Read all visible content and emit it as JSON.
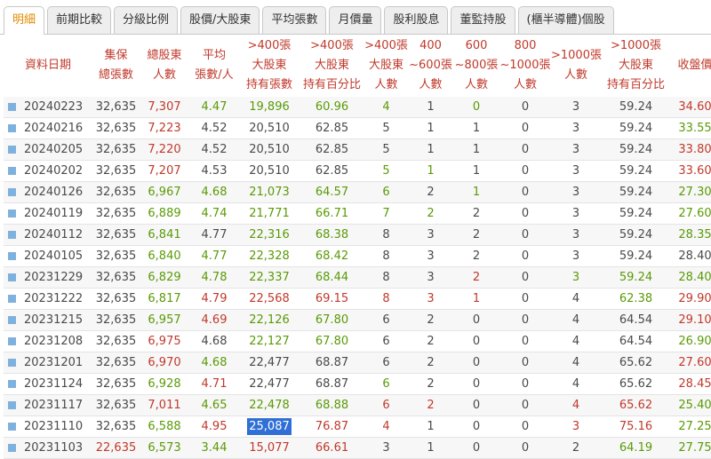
{
  "tabs": [
    "明細",
    "前期比較",
    "分級比例",
    "股價/大股東",
    "平均張數",
    "月價量",
    "股利股息",
    "董監持股",
    "(櫃半導體)個股"
  ],
  "active_tab": 0,
  "headers": [
    [
      "資料日期"
    ],
    [
      "集保",
      "總張數"
    ],
    [
      "總股東",
      "人數"
    ],
    [
      "平均",
      "張數/人"
    ],
    [
      ">400張",
      "大股東",
      "持有張數"
    ],
    [
      ">400張",
      "大股東",
      "持有百分比"
    ],
    [
      ">400張",
      "大股東",
      "人數"
    ],
    [
      "400",
      "~600張",
      "人數"
    ],
    [
      "600",
      "~800張",
      "人數"
    ],
    [
      "800",
      "~1000張",
      "人數"
    ],
    [
      ">1000張",
      "人數"
    ],
    [
      ">1000張",
      "大股東",
      "持有百分比"
    ],
    [
      "收盤價"
    ]
  ],
  "rows": [
    [
      "20240223",
      "32,635",
      "7,307",
      "4.47",
      "19,896",
      "60.96",
      "4",
      "1",
      "0",
      "0",
      "3",
      "59.24",
      "34.60"
    ],
    [
      "20240216",
      "32,635",
      "7,223",
      "4.52",
      "20,510",
      "62.85",
      "5",
      "1",
      "1",
      "0",
      "3",
      "59.24",
      "33.55"
    ],
    [
      "20240205",
      "32,635",
      "7,220",
      "4.52",
      "20,510",
      "62.85",
      "5",
      "1",
      "1",
      "0",
      "3",
      "59.24",
      "33.80"
    ],
    [
      "20240202",
      "32,635",
      "7,207",
      "4.53",
      "20,510",
      "62.85",
      "5",
      "1",
      "1",
      "0",
      "3",
      "59.24",
      "33.60"
    ],
    [
      "20240126",
      "32,635",
      "6,967",
      "4.68",
      "21,073",
      "64.57",
      "6",
      "2",
      "1",
      "0",
      "3",
      "59.24",
      "27.30"
    ],
    [
      "20240119",
      "32,635",
      "6,889",
      "4.74",
      "21,771",
      "66.71",
      "7",
      "2",
      "2",
      "0",
      "3",
      "59.24",
      "27.60"
    ],
    [
      "20240112",
      "32,635",
      "6,841",
      "4.77",
      "22,316",
      "68.38",
      "8",
      "3",
      "2",
      "0",
      "3",
      "59.24",
      "28.35"
    ],
    [
      "20240105",
      "32,635",
      "6,840",
      "4.77",
      "22,328",
      "68.42",
      "8",
      "3",
      "2",
      "0",
      "3",
      "59.24",
      "28.40"
    ],
    [
      "20231229",
      "32,635",
      "6,829",
      "4.78",
      "22,337",
      "68.44",
      "8",
      "3",
      "2",
      "0",
      "3",
      "59.24",
      "28.40"
    ],
    [
      "20231222",
      "32,635",
      "6,817",
      "4.79",
      "22,568",
      "69.15",
      "8",
      "3",
      "1",
      "0",
      "4",
      "62.38",
      "29.90"
    ],
    [
      "20231215",
      "32,635",
      "6,957",
      "4.69",
      "22,126",
      "67.80",
      "6",
      "2",
      "0",
      "0",
      "4",
      "64.54",
      "29.10"
    ],
    [
      "20231208",
      "32,635",
      "6,975",
      "4.68",
      "22,127",
      "67.80",
      "6",
      "2",
      "0",
      "0",
      "4",
      "64.54",
      "26.90"
    ],
    [
      "20231201",
      "32,635",
      "6,970",
      "4.68",
      "22,477",
      "68.87",
      "6",
      "2",
      "0",
      "0",
      "4",
      "65.62",
      "27.60"
    ],
    [
      "20231124",
      "32,635",
      "6,928",
      "4.71",
      "22,477",
      "68.87",
      "6",
      "2",
      "0",
      "0",
      "4",
      "65.62",
      "28.45"
    ],
    [
      "20231117",
      "32,635",
      "7,011",
      "4.65",
      "22,478",
      "68.88",
      "6",
      "2",
      "0",
      "0",
      "4",
      "65.62",
      "25.40"
    ],
    [
      "20231110",
      "32,635",
      "6,588",
      "4.95",
      "25,087",
      "76.87",
      "4",
      "1",
      "0",
      "0",
      "3",
      "75.16",
      "27.25"
    ],
    [
      "20231103",
      "22,635",
      "6,573",
      "3.44",
      "15,077",
      "66.61",
      "3",
      "1",
      "0",
      "0",
      "2",
      "64.19",
      "27.75"
    ]
  ],
  "colors": [
    [
      "g",
      "g",
      "red",
      "green",
      "green",
      "green",
      "green",
      "g",
      "green",
      "g",
      "g",
      "g",
      "red"
    ],
    [
      "g",
      "g",
      "red",
      "g",
      "g",
      "g",
      "g",
      "g",
      "g",
      "g",
      "g",
      "g",
      "green"
    ],
    [
      "g",
      "g",
      "red",
      "g",
      "g",
      "g",
      "g",
      "g",
      "g",
      "g",
      "g",
      "g",
      "red"
    ],
    [
      "g",
      "g",
      "red",
      "g",
      "g",
      "g",
      "green",
      "green",
      "g",
      "g",
      "g",
      "g",
      "red"
    ],
    [
      "g",
      "g",
      "green",
      "green",
      "green",
      "green",
      "green",
      "g",
      "green",
      "g",
      "g",
      "g",
      "green"
    ],
    [
      "g",
      "g",
      "green",
      "green",
      "green",
      "green",
      "green",
      "green",
      "g",
      "g",
      "g",
      "g",
      "green"
    ],
    [
      "g",
      "g",
      "green",
      "g",
      "green",
      "green",
      "g",
      "g",
      "g",
      "g",
      "g",
      "g",
      "green"
    ],
    [
      "g",
      "g",
      "green",
      "green",
      "green",
      "green",
      "g",
      "g",
      "g",
      "g",
      "g",
      "g",
      "g"
    ],
    [
      "g",
      "g",
      "green",
      "green",
      "green",
      "green",
      "g",
      "g",
      "red",
      "g",
      "green",
      "green",
      "green"
    ],
    [
      "g",
      "g",
      "green",
      "red",
      "red",
      "red",
      "red",
      "red",
      "red",
      "g",
      "g",
      "green",
      "red"
    ],
    [
      "g",
      "g",
      "green",
      "red",
      "green",
      "green",
      "g",
      "g",
      "g",
      "g",
      "g",
      "g",
      "red"
    ],
    [
      "g",
      "g",
      "red",
      "g",
      "green",
      "green",
      "g",
      "g",
      "g",
      "g",
      "g",
      "g",
      "green"
    ],
    [
      "g",
      "g",
      "red",
      "green",
      "g",
      "g",
      "g",
      "g",
      "g",
      "g",
      "g",
      "g",
      "red"
    ],
    [
      "g",
      "g",
      "green",
      "red",
      "g",
      "g",
      "green",
      "g",
      "g",
      "g",
      "g",
      "g",
      "red"
    ],
    [
      "g",
      "g",
      "red",
      "green",
      "green",
      "green",
      "red",
      "red",
      "g",
      "g",
      "red",
      "red",
      "green"
    ],
    [
      "g",
      "g",
      "green",
      "red",
      "hl",
      "red",
      "red",
      "g",
      "g",
      "g",
      "red",
      "red",
      "green"
    ],
    [
      "g",
      "red",
      "green",
      "green",
      "red",
      "red",
      "g",
      "g",
      "g",
      "g",
      "g",
      "green",
      "green"
    ]
  ]
}
